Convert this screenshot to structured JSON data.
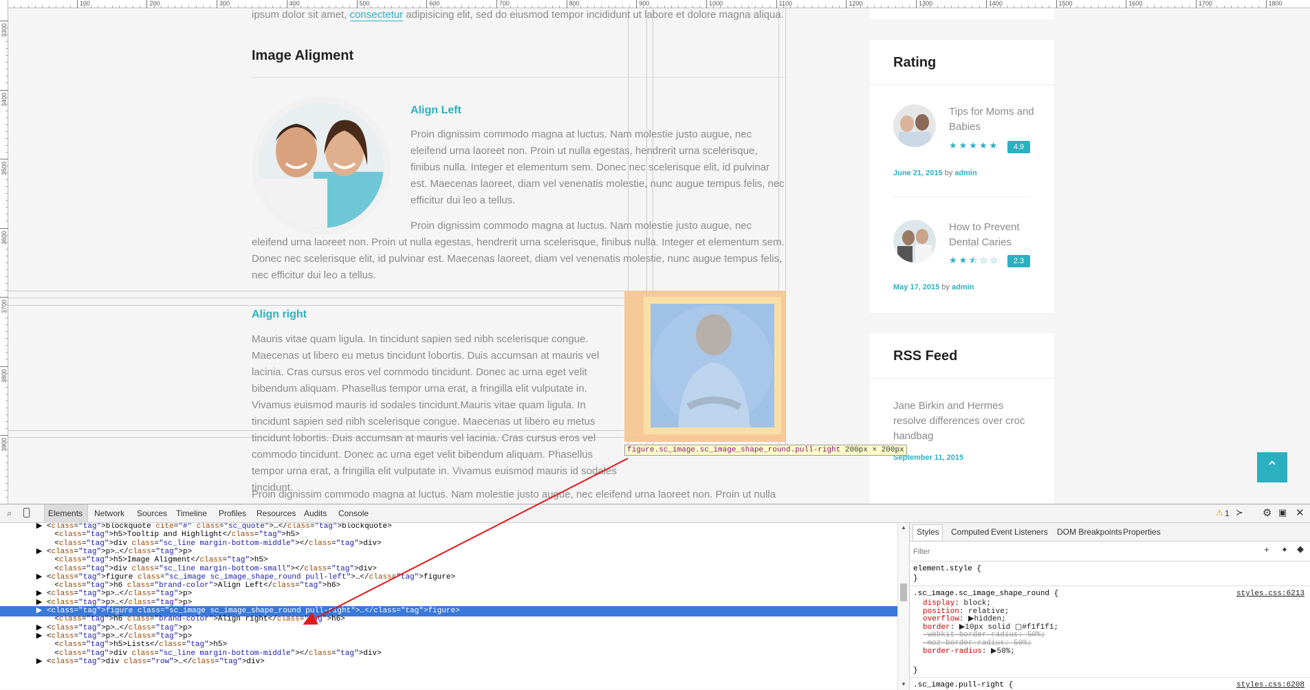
{
  "ruler": {
    "top_labels": [
      "100",
      "200",
      "300",
      "400",
      "500",
      "600",
      "700",
      "800",
      "900",
      "1000",
      "1100",
      "1200",
      "1300",
      "1400",
      "1500",
      "1600",
      "1700",
      "1800"
    ],
    "left_labels": [
      "3300",
      "3400",
      "3500",
      "3600",
      "3700",
      "3800",
      "3900"
    ]
  },
  "content": {
    "top_text_pre": "ipsum dolor sit amet, ",
    "top_text_link": "consectetur",
    "top_text_post": " adipisicing elit, sed do eiusmod tempor incididunt ut labore et dolore magna aliqua.",
    "section_title": "Image Aligment",
    "align_left_heading": "Align Left",
    "align_left_para1": "Proin dignissim commodo magna at luctus. Nam molestie justo augue, nec eleifend urna laoreet non. Proin ut nulla egestas, hendrerit urna scelerisque, finibus nulla. Integer et elementum sem. Donec nec scelerisque elit, id pulvinar est. Maecenas laoreet, diam vel venenatis molestie, nunc augue tempus felis, nec efficitur dui leo a tellus.",
    "align_left_para2": "Proin dignissim commodo magna at luctus. Nam molestie justo augue, nec eleifend urna laoreet non. Proin ut nulla egestas, hendrerit urna scelerisque, finibus nulla. Integer et elementum sem. Donec nec scelerisque elit, id pulvinar est. Maecenas laoreet, diam vel venenatis molestie, nunc augue tempus felis, nec efficitur dui leo a tellus.",
    "align_right_heading": "Align right",
    "align_right_para": "Mauris vitae quam ligula. In tincidunt sapien sed nibh scelerisque congue. Maecenas ut libero eu metus tincidunt lobortis. Duis accumsan at mauris vel lacinia. Cras cursus eros vel commodo tincidunt. Donec ac urna eget velit bibendum aliquam. Phasellus tempor urna erat, a fringilla elit vulputate in. Vivamus euismod mauris id sodales tincidunt.Mauris vitae quam ligula. In tincidunt sapien sed nibh scelerisque congue. Maecenas ut libero eu metus tincidunt lobortis. Duis accumsan at mauris vel lacinia. Cras cursus eros vel commodo tincidunt. Donec ac urna eget velit bibendum aliquam. Phasellus tempor urna erat, a fringilla elit vulputate in. Vivamus euismod mauris id sodales tincidunt.",
    "bottom_para": "Proin dignissim commodo magna at luctus. Nam molestie justo augue, nec eleifend urna laoreet non. Proin ut nulla",
    "tooltip_selector": "figure.sc_image.sc_image_shape_round.pull-right",
    "tooltip_size": "200px × 200px"
  },
  "sidebar": {
    "rating_title": "Rating",
    "posts": [
      {
        "title": "Tips for Moms and Babies",
        "stars": "★★★★★",
        "score": "4.9",
        "date": "June 21, 2015",
        "by": "by",
        "author": "admin"
      },
      {
        "title": "How to Prevent Dental Caries",
        "stars": "★★⯪☆☆",
        "score": "2.3",
        "date": "May 17, 2015",
        "by": "by",
        "author": "admin"
      }
    ],
    "rss_title": "RSS Feed",
    "rss_item": "Jane Birkin and Hermes resolve differences over croc handbag",
    "rss_date": "September 11, 2015"
  },
  "scroll_top_icon": "chevron-up-icon",
  "devtools": {
    "tabs": [
      "Elements",
      "Network",
      "Sources",
      "Timeline",
      "Profiles",
      "Resources",
      "Audits",
      "Console"
    ],
    "warning_count": "1",
    "dom_lines": [
      {
        "indent": "        ",
        "arrow": "▶",
        "html": "<blockquote cite=\"#\" class=\"sc_quote\">…</blockquote>"
      },
      {
        "indent": "          ",
        "arrow": "",
        "html": "<h5>Tooltip and Highlight</h5>"
      },
      {
        "indent": "          ",
        "arrow": "",
        "html": "<div class=\"sc_line margin-bottom-middle\"></div>"
      },
      {
        "indent": "        ",
        "arrow": "▶",
        "html": "<p>…</p>"
      },
      {
        "indent": "          ",
        "arrow": "",
        "html": "<h5>Image Aligment</h5>"
      },
      {
        "indent": "          ",
        "arrow": "",
        "html": "<div class=\"sc_line margin-bottom-small\"></div>"
      },
      {
        "indent": "        ",
        "arrow": "▶",
        "html": "<figure class=\"sc_image sc_image_shape_round pull-left\">…</figure>"
      },
      {
        "indent": "          ",
        "arrow": "",
        "html": "<h6 class=\"brand-color\">Align Left</h6>"
      },
      {
        "indent": "        ",
        "arrow": "▶",
        "html": "<p>…</p>"
      },
      {
        "indent": "        ",
        "arrow": "▶",
        "html": "<p>…</p>"
      },
      {
        "indent": "        ",
        "arrow": "▶",
        "html": "<figure class=\"sc_image sc_image_shape_round pull-right\">…</figure>",
        "selected": true
      },
      {
        "indent": "          ",
        "arrow": "",
        "html": "<h6 class=\"brand-color\">Align right</h6>"
      },
      {
        "indent": "        ",
        "arrow": "▶",
        "html": "<p>…</p>"
      },
      {
        "indent": "        ",
        "arrow": "▶",
        "html": "<p>…</p>"
      },
      {
        "indent": "          ",
        "arrow": "",
        "html": "<h5>Lists</h5>"
      },
      {
        "indent": "          ",
        "arrow": "",
        "html": "<div class=\"sc_line margin-bottom-middle\"></div>"
      },
      {
        "indent": "        ",
        "arrow": "▶",
        "html": "<div class=\"row\">…</div>"
      }
    ],
    "style_tabs": [
      "Styles",
      "Computed",
      "Event Listeners",
      "DOM Breakpoints",
      "Properties"
    ],
    "filter_placeholder": "Filter",
    "css": {
      "element_style": "element.style {",
      "close": "}",
      "rule1_selector": ".sc_image.sc_image_shape_round {",
      "rule1_source": "styles.css:6213",
      "rule1_props": [
        {
          "p": "display",
          "v": "block;",
          "struck": false
        },
        {
          "p": "position",
          "v": "relative;",
          "struck": false
        },
        {
          "p": "overflow",
          "v": "▶hidden;",
          "struck": false
        },
        {
          "p": "border",
          "v": "▶10px solid ▢#f1f1f1;",
          "struck": false
        },
        {
          "p": "-webkit-border-radius",
          "v": "50%;",
          "struck": true
        },
        {
          "p": "-moz-border-radius",
          "v": "50%;",
          "struck": true
        },
        {
          "p": "border-radius",
          "v": "▶50%;",
          "struck": false
        }
      ],
      "rule2_selector": ".sc_image.pull-right {",
      "rule2_source": "styles.css:6208"
    }
  },
  "colors": {
    "brand": "#2bb0c0",
    "selection": "#3879d9",
    "highlight_margin": "#f6c48f",
    "highlight_content": "#9fc1e6"
  }
}
